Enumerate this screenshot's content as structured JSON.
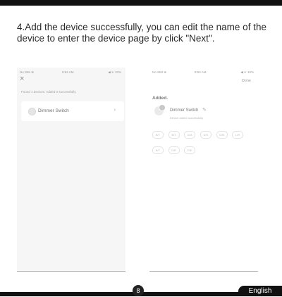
{
  "instruction": "4.Add the device successfully, you can edit the name of the device to enter the device page by click \"Next\".",
  "left_screen": {
    "status": {
      "carrier": "No SIM ⊕",
      "time": "8:54 AM",
      "battery": "◀ ✈ 10%"
    },
    "close_icon": "close-icon",
    "found_text": "Found 1 devices. Added 0 successfully.",
    "device": {
      "name": "Dimmer Switch",
      "arrow": "›"
    }
  },
  "right_screen": {
    "status": {
      "carrier": "No SIM ⊕",
      "time": "8:54 AM",
      "battery": "◀ ✈ 10%"
    },
    "done_label": "Done",
    "added_label": "Added.",
    "device_name": "Dimmer Switch",
    "device_status": "Device added successfully",
    "rooms": [
      "B/T",
      "B/T",
      "D/A",
      "D/S",
      "O/B",
      "L/R",
      "B/T",
      "G/R",
      "P/E"
    ]
  },
  "footer": {
    "page_number": "8",
    "language": "English"
  }
}
